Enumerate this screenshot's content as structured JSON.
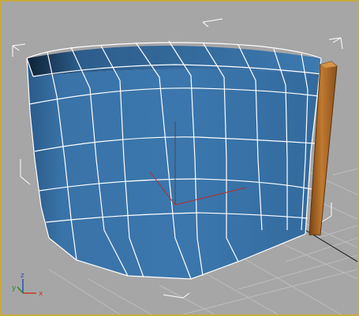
{
  "viewport": {
    "active_border_color": "#c8aa3c",
    "background_color": "#a6a6a6",
    "grid_color": "#bdbdbd",
    "object": "cylinder",
    "object_color": "#3a73a8",
    "wireframe_color": "#ffffff",
    "pole_color": "#b06a23"
  },
  "axis_tripod": {
    "x_label": "x",
    "y_label": "y",
    "z_label": "z",
    "x_color": "#c0392b",
    "y_color": "#2e8b2e",
    "z_color": "#2c4fb5"
  }
}
